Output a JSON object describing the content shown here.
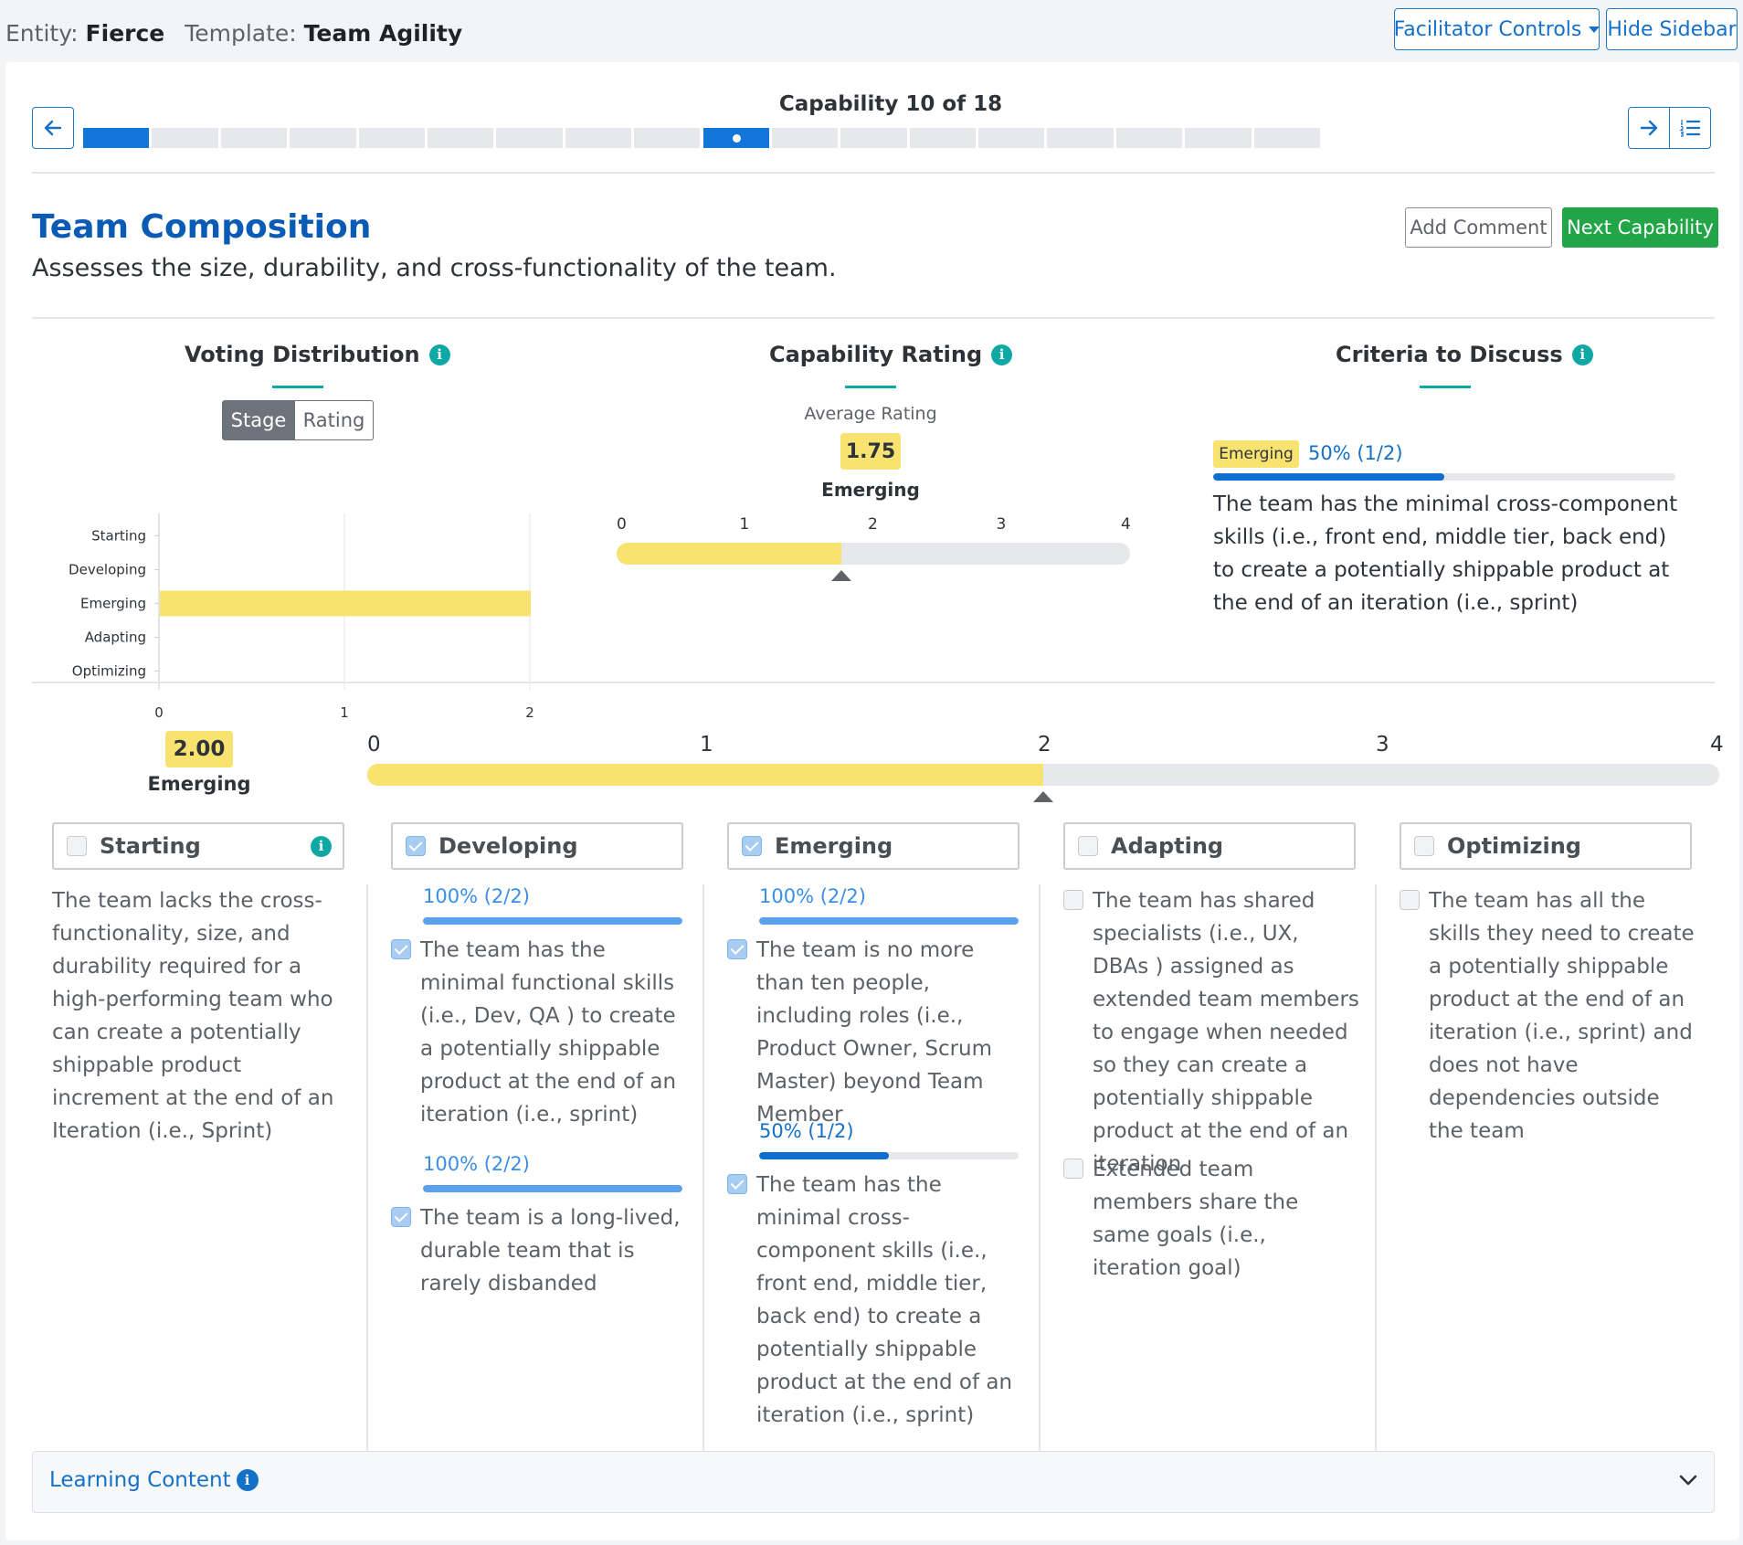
{
  "header": {
    "entity_label": "Entity:",
    "entity_value": "Fierce",
    "template_label": "Template:",
    "template_value": "Team Agility",
    "facilitator_controls": "Facilitator Controls",
    "hide_sidebar": "Hide Sidebar"
  },
  "progress": {
    "label": "Capability 10 of 18",
    "current": 10,
    "total": 18
  },
  "capability": {
    "title": "Team Composition",
    "description": "Assesses the size, durability, and cross-functionality of the team.",
    "add_comment": "Add Comment",
    "next_capability": "Next Capability"
  },
  "voting": {
    "title": "Voting Distribution",
    "toggle_stage": "Stage",
    "toggle_rating": "Rating",
    "chart_data": {
      "type": "bar",
      "orientation": "horizontal",
      "categories": [
        "Starting",
        "Developing",
        "Emerging",
        "Adapting",
        "Optimizing"
      ],
      "values": [
        0,
        0,
        2,
        0,
        0
      ],
      "xlim": [
        0,
        2
      ],
      "xticks": [
        "0",
        "1",
        "2"
      ],
      "bar_color": "#f8e370",
      "grid": true
    }
  },
  "rating": {
    "title": "Capability Rating",
    "avg_label": "Average Rating",
    "avg_value": "1.75",
    "avg_stage": "Emerging",
    "scale": [
      "0",
      "1",
      "2",
      "3",
      "4"
    ],
    "value": 1.75,
    "max": 4
  },
  "criteria": {
    "title": "Criteria to Discuss",
    "badge": "Emerging",
    "pct": "50% (1/2)",
    "fill": 0.5,
    "text": "The team has the minimal cross-component skills (i.e., front end, middle tier, back end) to create a potentially shippable product at the end of an iteration (i.e., sprint)"
  },
  "overall": {
    "score": "2.00",
    "stage": "Emerging",
    "scale": [
      "0",
      "1",
      "2",
      "3",
      "4"
    ],
    "value": 2.0,
    "max": 4
  },
  "stages": [
    {
      "name": "Starting",
      "checked": false,
      "description": "The team lacks the cross-functionality, size, and durability required for a high-performing team who can create a potentially shippable product increment at the end of an Iteration (i.e., Sprint)"
    },
    {
      "name": "Developing",
      "checked": true,
      "criteria": [
        {
          "pct": "100% (2/2)",
          "fill": 1.0,
          "text": "The team has the minimal functional skills (i.e., Dev, QA ) to create a potentially shippable product at the end of an iteration (i.e., sprint)"
        },
        {
          "pct": "100% (2/2)",
          "fill": 1.0,
          "text": "The team is a long-lived, durable team that is rarely disbanded"
        }
      ]
    },
    {
      "name": "Emerging",
      "checked": true,
      "criteria": [
        {
          "pct": "100% (2/2)",
          "fill": 1.0,
          "text": "The team is no more than ten people, including roles (i.e., Product Owner, Scrum Master) beyond Team Member"
        },
        {
          "pct": "50% (1/2)",
          "fill": 0.5,
          "text": "The team has the minimal cross-component skills (i.e., front end, middle tier, back end) to create a potentially shippable product at the end of an iteration (i.e., sprint)"
        }
      ]
    },
    {
      "name": "Adapting",
      "checked": false,
      "criteria": [
        {
          "text": "The team has shared specialists (i.e., UX, DBAs ) assigned as extended team members to engage when needed so they can create a potentially shippable product at the end of an iteration"
        },
        {
          "text": "Extended team members share the same goals (i.e., iteration goal)"
        }
      ]
    },
    {
      "name": "Optimizing",
      "checked": false,
      "criteria": [
        {
          "text": "The team has all the skills they need to create a potentially shippable product at the end of an iteration (i.e., sprint) and does not have dependencies outside the team"
        }
      ]
    }
  ],
  "learning": {
    "title": "Learning Content"
  },
  "colors": {
    "primary": "#1176d8",
    "title_blue": "#0a5bb5",
    "success": "#21a546",
    "teal": "#0fa8a4",
    "highlight_yellow": "#f8e370"
  },
  "icons": {
    "prev": "arrow-left-icon",
    "next": "arrow-right-icon",
    "list": "numbered-list-icon",
    "info": "info-icon",
    "expand": "chevron-down-icon"
  }
}
